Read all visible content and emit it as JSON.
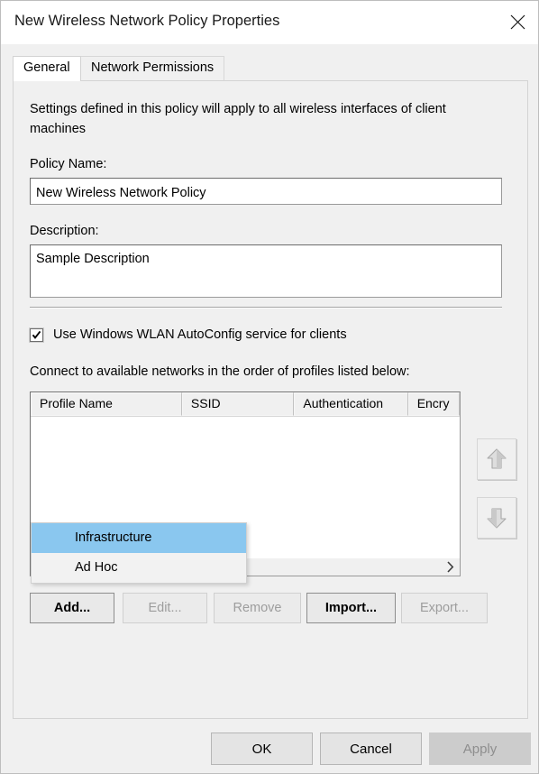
{
  "window": {
    "title": "New Wireless Network Policy Properties",
    "close_icon": "close-icon"
  },
  "tabs": [
    {
      "label": "General",
      "active": true
    },
    {
      "label": "Network Permissions",
      "active": false
    }
  ],
  "general": {
    "description_text": "Settings defined in this policy will apply to all wireless interfaces of client machines",
    "policy_name_label": "Policy Name:",
    "policy_name_value": "New Wireless Network Policy",
    "description_label": "Description:",
    "description_value": "Sample Description",
    "autoconfig_checkbox_label": "Use Windows WLAN AutoConfig service for clients",
    "autoconfig_checked": true,
    "profiles_list_label": "Connect to available networks in the order of profiles listed below:",
    "profile_columns": [
      "Profile Name",
      "SSID",
      "Authentication",
      "Encry"
    ],
    "profile_rows": [],
    "move_up_label": "Move up",
    "move_down_label": "Move down",
    "scroll_right_arrow": ">"
  },
  "profile_buttons": [
    {
      "label": "Add...",
      "enabled": true,
      "name": "add-button"
    },
    {
      "label": "Edit...",
      "enabled": false,
      "name": "edit-button"
    },
    {
      "label": "Remove",
      "enabled": false,
      "name": "remove-button"
    },
    {
      "label": "Import...",
      "enabled": true,
      "name": "import-button"
    },
    {
      "label": "Export...",
      "enabled": false,
      "name": "export-button"
    }
  ],
  "dropdown": {
    "items": [
      {
        "label": "Infrastructure",
        "selected": true
      },
      {
        "label": "Ad Hoc",
        "selected": false
      }
    ]
  },
  "dialog_buttons": {
    "ok": "OK",
    "cancel": "Cancel",
    "apply": "Apply"
  },
  "colors": {
    "dialog_bg": "#f0f0f0",
    "titlebar_bg": "#ffffff",
    "selection_blue": "#8ac7ef",
    "field_bg": "#ffffff",
    "disabled_text": "#9d9d9d",
    "scroll_thumb": "#cdcdcd"
  }
}
